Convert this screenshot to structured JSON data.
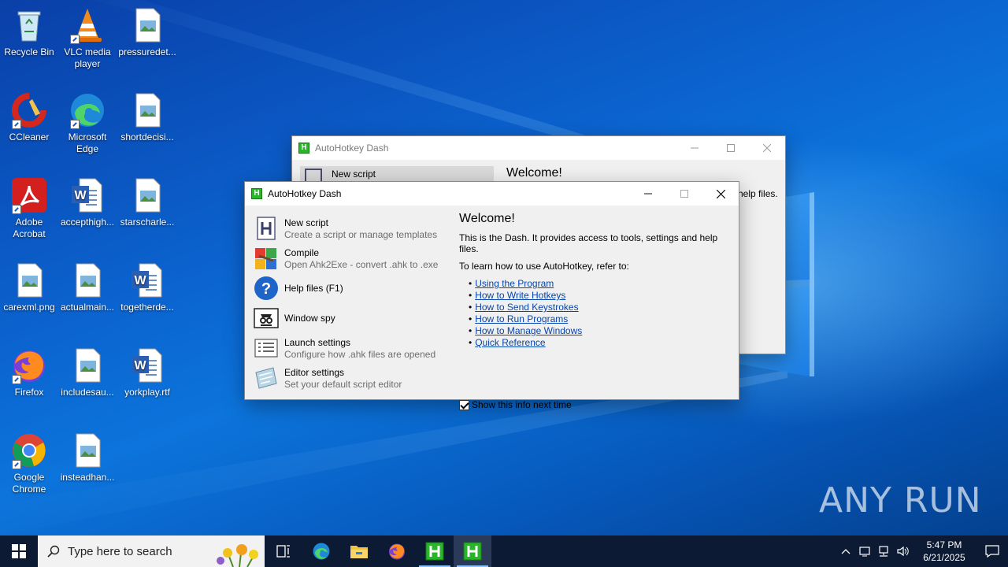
{
  "desktop": {
    "icons": [
      {
        "label": "Recycle Bin"
      },
      {
        "label": "VLC media player"
      },
      {
        "label": "pressuredet..."
      },
      {
        "label": "CCleaner"
      },
      {
        "label": "Microsoft Edge"
      },
      {
        "label": "shortdecisi..."
      },
      {
        "label": "Adobe Acrobat"
      },
      {
        "label": "accepthigh..."
      },
      {
        "label": "starscharle..."
      },
      {
        "label": "carexml.png"
      },
      {
        "label": "actualmain..."
      },
      {
        "label": "togetherde..."
      },
      {
        "label": "Firefox"
      },
      {
        "label": "includesau..."
      },
      {
        "label": "yorkplay.rtf"
      },
      {
        "label": "Google Chrome"
      },
      {
        "label": "insteadhan..."
      }
    ]
  },
  "back_window": {
    "title": "AutoHotkey Dash",
    "partial_item": "New script",
    "partial_heading": "Welcome!",
    "partial_text": "help files."
  },
  "dash": {
    "title": "AutoHotkey Dash",
    "items": [
      {
        "title": "New script",
        "desc": "Create a script or manage templates"
      },
      {
        "title": "Compile",
        "desc": "Open Ahk2Exe - convert .ahk to .exe"
      },
      {
        "title": "Help files (F1)",
        "desc": ""
      },
      {
        "title": "Window spy",
        "desc": ""
      },
      {
        "title": "Launch settings",
        "desc": "Configure how .ahk files are opened"
      },
      {
        "title": "Editor settings",
        "desc": "Set your default script editor"
      }
    ],
    "welcome": {
      "heading": "Welcome!",
      "intro": "This is the Dash. It provides access to tools, settings and help files.",
      "learn": "To learn how to use AutoHotkey, refer to:",
      "links": [
        "Using the Program",
        "How to Write Hotkeys",
        "How to Send Keystrokes",
        "How to Run Programs",
        "How to Manage Windows",
        "Quick Reference"
      ],
      "checkbox_label": "Show this info next time",
      "checkbox_checked": true
    }
  },
  "taskbar": {
    "search_placeholder": "Type here to search",
    "time": "5:47 PM",
    "date": "6/21/2025"
  },
  "watermark": {
    "text": "ANY RUN"
  },
  "colors": {
    "link": "#0645ad",
    "ahk_green": "#2bb52b",
    "taskbar": "#0c1a33"
  }
}
